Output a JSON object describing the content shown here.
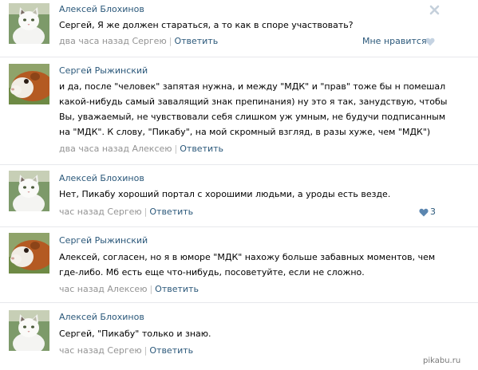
{
  "comments": [
    {
      "author": "Алексей Блохинов",
      "lines": [
        "Сергей, Я же должен стараться, а то как в споре участвовать?"
      ],
      "time": "два часа назад Сергею",
      "reply": "Ответить",
      "like_label": "Мне нравится",
      "avatar": "white-cat-photo"
    },
    {
      "author": "Сергей Рыжинский",
      "lines": [
        "и да, после \"человек\" запятая нужна, и между \"МДК\" и \"прав\" тоже бы н помешал",
        "какой-нибудь самый завалящий знак препинания) ну это я так, занудствую, чтобы",
        "Вы, уважаемый, не чувствовали себя слишком уж умным, не будучи подписанным",
        "на \"МДК\". К слову, \"Пикабу\", на мой скромный взгляд, в разы хуже, чем \"МДК\")"
      ],
      "time": "два часа назад Алексею",
      "reply": "Ответить",
      "avatar": "guinea-pig-photo"
    },
    {
      "author": "Алексей Блохинов",
      "lines": [
        "Нет, Пикабу хороший портал с хорошими людьми, а уроды есть везде."
      ],
      "time": "час назад Сергею",
      "reply": "Ответить",
      "likes": "3",
      "avatar": "white-cat-photo"
    },
    {
      "author": "Сергей Рыжинский",
      "lines": [
        "Алексей, согласен, но я в юморе \"МДК\" нахожу больше забавных моментов, чем",
        "где-либо. Мб есть еще что-нибудь, посоветуйте, если не сложно."
      ],
      "time": "час назад Алексею",
      "reply": "Ответить",
      "avatar": "guinea-pig-photo"
    },
    {
      "author": "Алексей Блохинов",
      "lines": [
        "Сергей, \"Пикабу\" только и знаю."
      ],
      "time": "час назад Сергею",
      "reply": "Ответить",
      "avatar": "white-cat-photo"
    }
  ],
  "watermark": "pikabu.ru",
  "colors": {
    "link": "#2b587a",
    "meta": "#939393",
    "heart": "#9fb7cf"
  }
}
